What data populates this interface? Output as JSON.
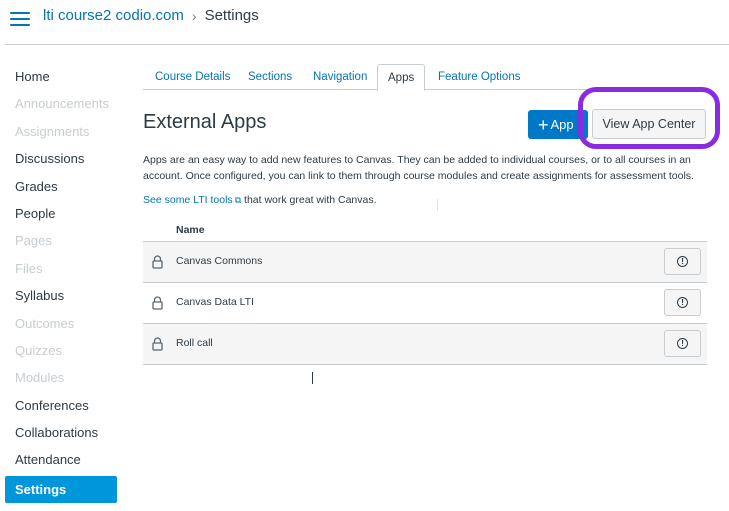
{
  "header": {
    "course_link": "lti course2 codio.com",
    "separator": "›",
    "current_page": "Settings"
  },
  "sidebar": {
    "items": [
      {
        "label": "Home",
        "state": "normal"
      },
      {
        "label": "Announcements",
        "state": "disabled"
      },
      {
        "label": "Assignments",
        "state": "disabled"
      },
      {
        "label": "Discussions",
        "state": "normal"
      },
      {
        "label": "Grades",
        "state": "normal"
      },
      {
        "label": "People",
        "state": "normal"
      },
      {
        "label": "Pages",
        "state": "disabled"
      },
      {
        "label": "Files",
        "state": "disabled"
      },
      {
        "label": "Syllabus",
        "state": "normal"
      },
      {
        "label": "Outcomes",
        "state": "disabled"
      },
      {
        "label": "Quizzes",
        "state": "disabled"
      },
      {
        "label": "Modules",
        "state": "disabled"
      },
      {
        "label": "Conferences",
        "state": "normal"
      },
      {
        "label": "Collaborations",
        "state": "normal"
      },
      {
        "label": "Attendance",
        "state": "normal"
      },
      {
        "label": "Settings",
        "state": "active"
      }
    ]
  },
  "tabs": [
    {
      "label": "Course Details",
      "active": false
    },
    {
      "label": "Sections",
      "active": false
    },
    {
      "label": "Navigation",
      "active": false
    },
    {
      "label": "Apps",
      "active": true
    },
    {
      "label": "Feature Options",
      "active": false
    }
  ],
  "main": {
    "title": "External Apps",
    "add_app_label": "App",
    "add_app_icon": "+",
    "view_app_center_label": "View App Center",
    "description": "Apps are an easy way to add new features to Canvas. They can be added to individual courses, or to all courses in an account. Once configured, you can link to them through course modules and create assignments for assessment tools.",
    "lti_link_text": "See some LTI tools",
    "lti_link_icon": "external-link-icon",
    "lti_suffix": " that work great with Canvas.",
    "column_name": "Name"
  },
  "apps": [
    {
      "name": "Canvas Commons",
      "icon": "lock-icon"
    },
    {
      "name": "Canvas Data LTI",
      "icon": "lock-icon"
    },
    {
      "name": "Roll call",
      "icon": "lock-icon"
    }
  ],
  "colors": {
    "link": "#0374b5",
    "active_nav": "#0096db",
    "primary_button": "#0078c8",
    "highlight_ring": "#8a2be2"
  }
}
